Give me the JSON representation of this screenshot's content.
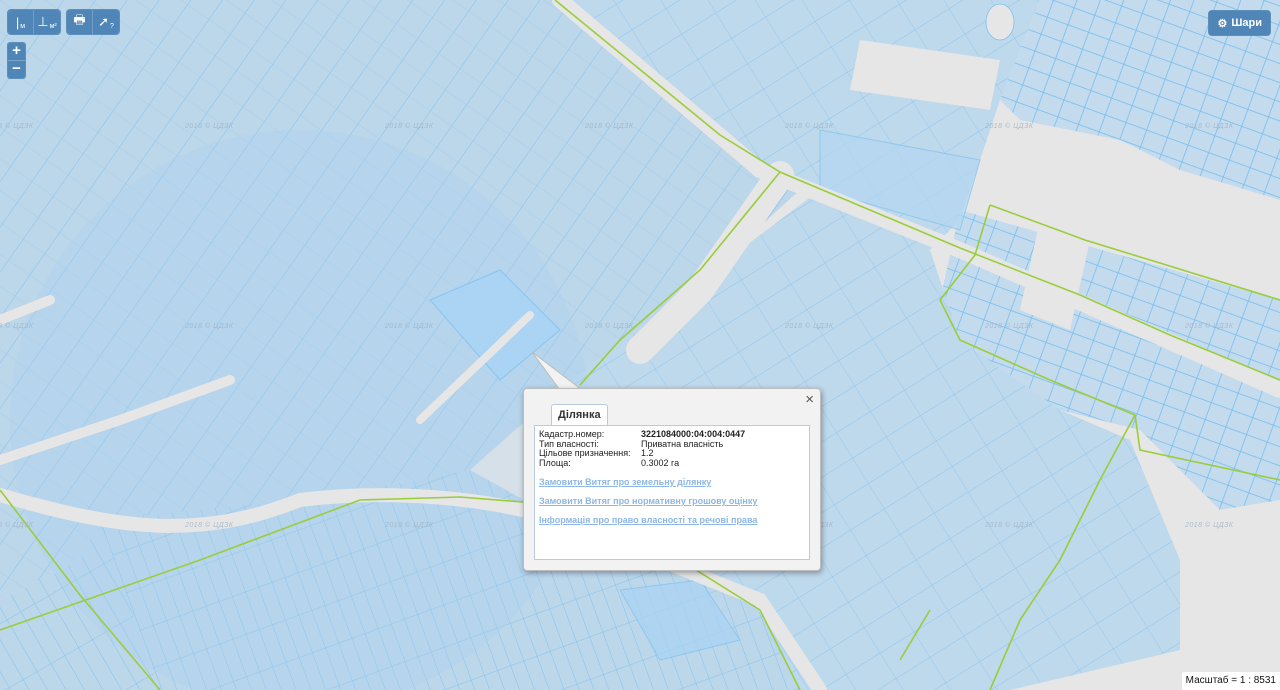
{
  "toolbar": {
    "group1": [
      {
        "name": "measure-length-icon",
        "glyph": "|",
        "sub": "м"
      },
      {
        "name": "measure-area-icon",
        "glyph": "⊥",
        "sub": "м²"
      }
    ],
    "group2": [
      {
        "name": "print-icon",
        "glyph": "🖶",
        "sub": ""
      },
      {
        "name": "identify-icon",
        "glyph": "➚",
        "sub": "?"
      }
    ],
    "zoom_in": "+",
    "zoom_out": "−",
    "layers_label": "Шари",
    "layers_icon": "gear-icon"
  },
  "watermark": "2018 © ЦДЗК",
  "popup": {
    "tab_label": "Ділянка",
    "close_label": "×",
    "fields": [
      {
        "key": "Кадастр.номер:",
        "value": "3221084000:04:004:0447",
        "bold": true
      },
      {
        "key": "Тип власності:",
        "value": "Приватна власність",
        "bold": false
      },
      {
        "key": "Цільове призначення:",
        "value": "1.2",
        "bold": false
      },
      {
        "key": "Площа:",
        "value": "0.3002 га",
        "bold": false
      }
    ],
    "links": [
      "Замовити Витяг про земельну ділянку",
      "Замовити Витяг про нормативну грошову оцінку",
      "Інформація про право власності та речові права"
    ]
  },
  "scale_text": "Масштаб = 1 : 8531",
  "colors": {
    "parcel_fill": "#bcd6ea",
    "parcel_stroke": "#7ec1ef",
    "boundary_line": "#9acd3a",
    "road": "#e6e6e6",
    "buttons": "#4f86b7"
  }
}
